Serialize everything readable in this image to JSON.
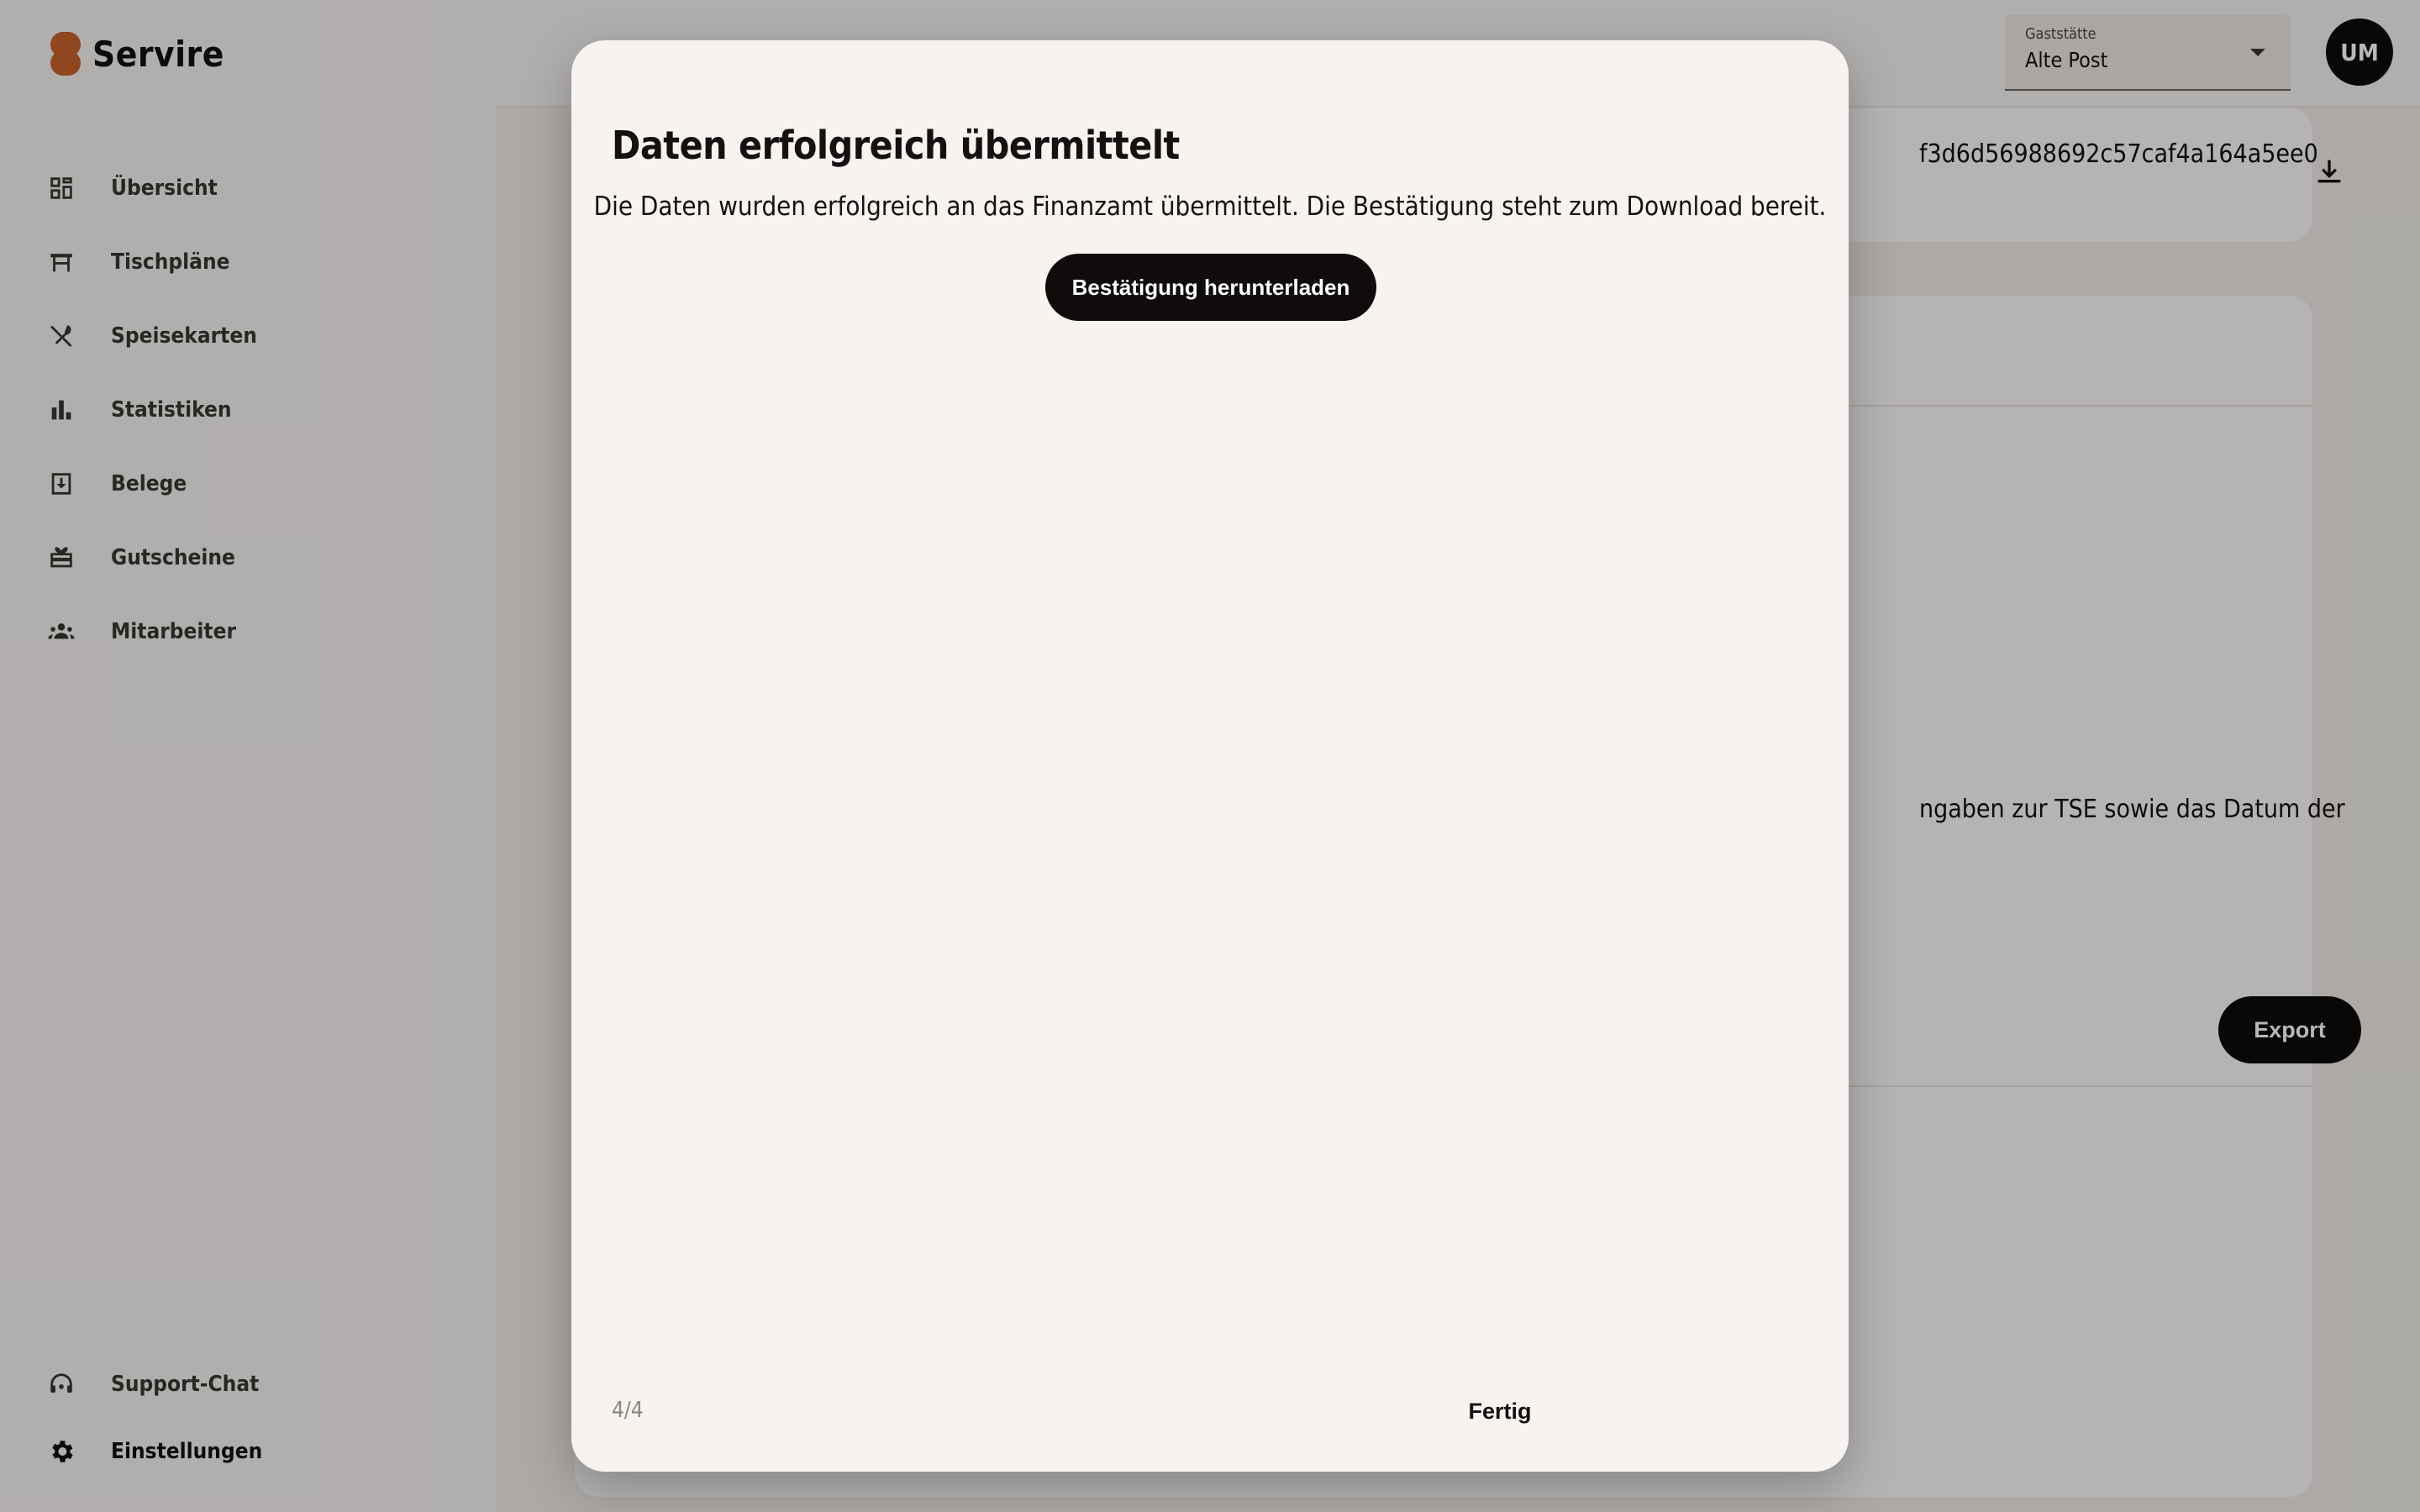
{
  "app": {
    "brand": "Servire",
    "brand_color": "#c8612a"
  },
  "sidebar": {
    "items": [
      {
        "label": "Übersicht",
        "icon": "dashboard-icon"
      },
      {
        "label": "Tischpläne",
        "icon": "table-icon"
      },
      {
        "label": "Speisekarten",
        "icon": "cutlery-icon"
      },
      {
        "label": "Statistiken",
        "icon": "bar-chart-icon"
      },
      {
        "label": "Belege",
        "icon": "archive-icon"
      },
      {
        "label": "Gutscheine",
        "icon": "gift-card-icon"
      },
      {
        "label": "Mitarbeiter",
        "icon": "people-icon"
      }
    ],
    "bottom_items": [
      {
        "label": "Support-Chat",
        "icon": "headset-icon"
      },
      {
        "label": "Einstellungen",
        "icon": "gear-icon",
        "active": true
      }
    ]
  },
  "header": {
    "venue_caption": "Gaststätte",
    "venue_value": "Alte Post",
    "avatar_initials": "UM"
  },
  "background": {
    "hash_fragment": "f3d6d56988692c57caf4a164a5ee0",
    "tse_text_fragment": "ngaben zur TSE sowie das Datum der",
    "export_label": "Export"
  },
  "dialog": {
    "title": "Daten erfolgreich übermittelt",
    "message": "Die Daten wurden erfolgreich an das Finanzamt übermittelt. Die Bestätigung steht zum Download bereit.",
    "download_label": "Bestätigung herunterladen",
    "step": "4/4",
    "done_label": "Fertig"
  }
}
